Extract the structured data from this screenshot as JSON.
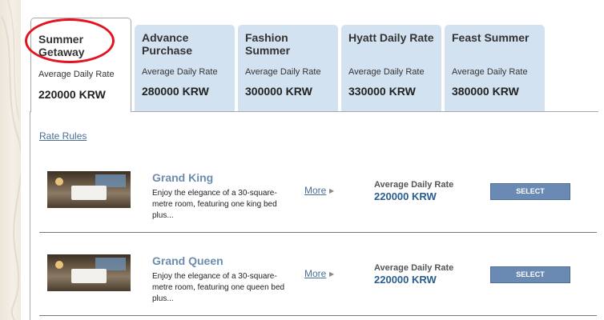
{
  "tabs": [
    {
      "name": "Summer Getaway",
      "rate_label": "Average Daily Rate",
      "rate_value": "220000 KRW",
      "active": true
    },
    {
      "name": "Advance Purchase",
      "rate_label": "Average Daily Rate",
      "rate_value": "280000 KRW",
      "active": false
    },
    {
      "name": "Fashion Summer",
      "rate_label": "Average Daily Rate",
      "rate_value": "300000 KRW",
      "active": false
    },
    {
      "name": "Hyatt Daily Rate",
      "rate_label": "Average Daily Rate",
      "rate_value": "330000 KRW",
      "active": false
    },
    {
      "name": "Feast Summer",
      "rate_label": "Average Daily Rate",
      "rate_value": "380000 KRW",
      "active": false
    }
  ],
  "rate_rules_label": "Rate Rules",
  "rooms": [
    {
      "name": "Grand King",
      "description": "Enjoy the elegance of a 30-square-metre room, featuring one king bed plus...",
      "more_label": "More",
      "rate_label": "Average Daily Rate",
      "rate_value": "220000 KRW",
      "select_label": "SELECT"
    },
    {
      "name": "Grand Queen",
      "description": "Enjoy the elegance of a 30-square-metre room, featuring one queen bed plus...",
      "more_label": "More",
      "rate_label": "Average Daily Rate",
      "rate_value": "220000 KRW",
      "select_label": "SELECT"
    }
  ],
  "colors": {
    "tab_inactive_bg": "#d3e2f1",
    "link": "#4a6e96",
    "room_name": "#6b8cac",
    "rate_value": "#2a5d8f",
    "select_button": "#6a8ab4",
    "highlight": "#e3141f"
  },
  "icons": {
    "more_arrow": "triangle-right-icon",
    "room_photo": "room-photo"
  }
}
